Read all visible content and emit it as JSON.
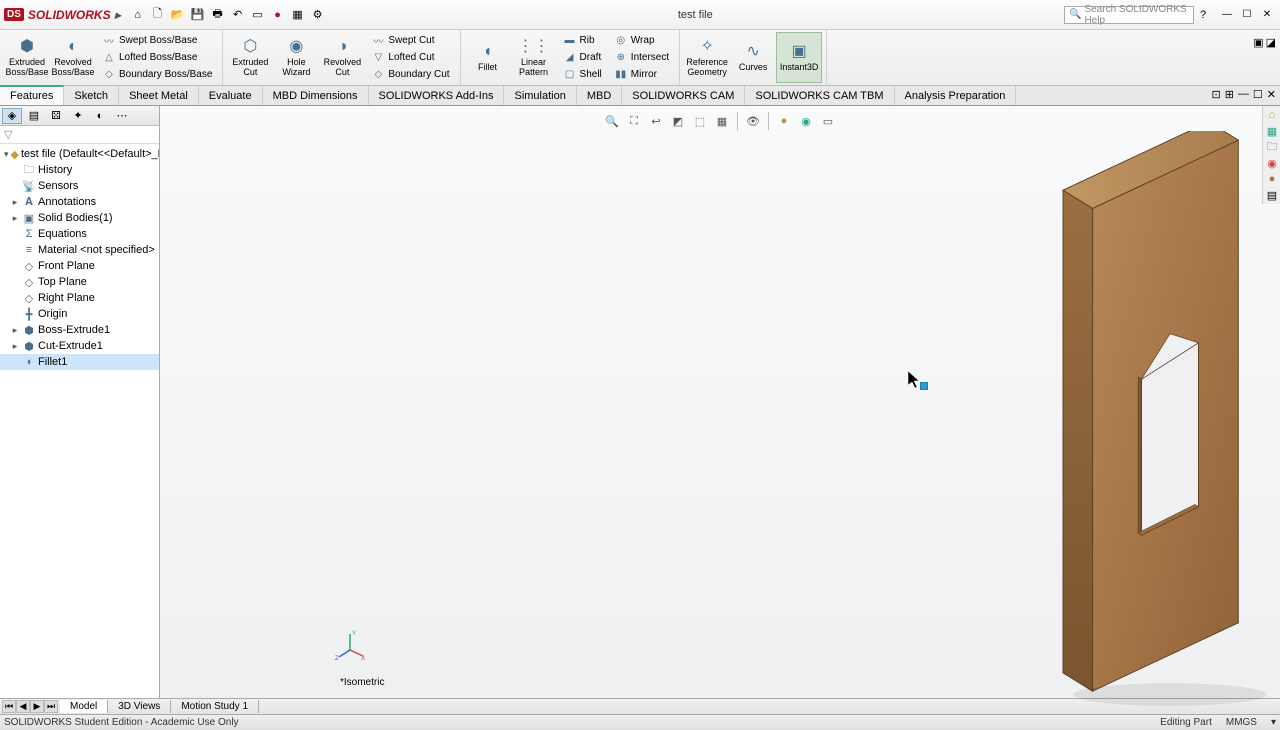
{
  "app": {
    "brand_prefix": "DS",
    "brand_name": "SOLIDWORKS",
    "document_title": "test file",
    "search_placeholder": "Search SOLIDWORKS Help"
  },
  "ribbon": {
    "extruded_boss": "Extruded Boss/Base",
    "revolved_boss": "Revolved Boss/Base",
    "swept_boss": "Swept Boss/Base",
    "lofted_boss": "Lofted Boss/Base",
    "boundary_boss": "Boundary Boss/Base",
    "extruded_cut": "Extruded Cut",
    "hole_wizard": "Hole Wizard",
    "revolved_cut": "Revolved Cut",
    "swept_cut": "Swept Cut",
    "lofted_cut": "Lofted Cut",
    "boundary_cut": "Boundary Cut",
    "fillet": "Fillet",
    "linear_pattern": "Linear Pattern",
    "rib": "Rib",
    "draft": "Draft",
    "shell": "Shell",
    "wrap": "Wrap",
    "intersect": "Intersect",
    "mirror": "Mirror",
    "ref_geom": "Reference Geometry",
    "curves": "Curves",
    "instant3d": "Instant3D"
  },
  "tabs": {
    "items": [
      "Features",
      "Sketch",
      "Sheet Metal",
      "Evaluate",
      "MBD Dimensions",
      "SOLIDWORKS Add-Ins",
      "Simulation",
      "MBD",
      "SOLIDWORKS CAM",
      "SOLIDWORKS CAM TBM",
      "Analysis Preparation"
    ],
    "active_index": 0
  },
  "tree": {
    "root": "test file  (Default<<Default>_Display",
    "items": [
      {
        "label": "History",
        "icon": "folder"
      },
      {
        "label": "Sensors",
        "icon": "sensor"
      },
      {
        "label": "Annotations",
        "icon": "annotation",
        "expandable": true
      },
      {
        "label": "Solid Bodies(1)",
        "icon": "body",
        "expandable": true
      },
      {
        "label": "Equations",
        "icon": "sigma"
      },
      {
        "label": "Material <not specified>",
        "icon": "material"
      },
      {
        "label": "Front Plane",
        "icon": "plane"
      },
      {
        "label": "Top Plane",
        "icon": "plane"
      },
      {
        "label": "Right Plane",
        "icon": "plane"
      },
      {
        "label": "Origin",
        "icon": "origin"
      },
      {
        "label": "Boss-Extrude1",
        "icon": "feature",
        "expandable": true
      },
      {
        "label": "Cut-Extrude1",
        "icon": "feature",
        "expandable": true
      },
      {
        "label": "Fillet1",
        "icon": "fillet",
        "selected": true
      }
    ]
  },
  "viewport": {
    "orientation_label": "*Isometric"
  },
  "bottom_tabs": {
    "items": [
      "Model",
      "3D Views",
      "Motion Study 1"
    ],
    "active_index": 0
  },
  "status": {
    "left": "SOLIDWORKS Student Edition - Academic Use Only",
    "editing": "Editing Part",
    "units": "MMGS"
  }
}
